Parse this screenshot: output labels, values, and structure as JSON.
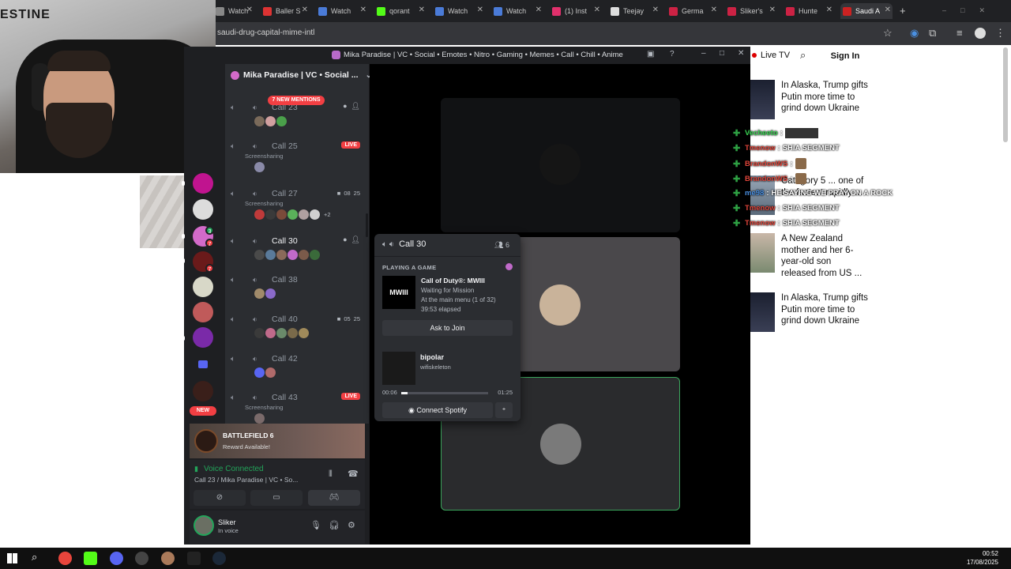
{
  "browser": {
    "tabs": [
      {
        "label": "Watch",
        "color": "#888888"
      },
      {
        "label": "Baller S",
        "color": "#dd3333"
      },
      {
        "label": "Watch",
        "color": "#4a7bd8"
      },
      {
        "label": "qorant",
        "color": "#53fc18"
      },
      {
        "label": "Watch",
        "color": "#4a7bd8"
      },
      {
        "label": "Watch",
        "color": "#4a7bd8"
      },
      {
        "label": "(1) Inst",
        "color": "#e1306c"
      },
      {
        "label": "Teejay",
        "color": "#dddddd"
      },
      {
        "label": "Germa",
        "color": "#cc2244"
      },
      {
        "label": "Sliker's",
        "color": "#cc2244"
      },
      {
        "label": "Hunte",
        "color": "#cc2244"
      },
      {
        "label": "Saudi A",
        "color": "#cc2222"
      }
    ],
    "url": "saudi-drug-capital-mime-intl"
  },
  "webcam": {
    "wall_text": "ESTINE"
  },
  "website": {
    "live_tv": "Live TV",
    "sign_in": "Sign In",
    "articles": [
      "In Alaska, Trump gifts Putin more time to grind down Ukraine",
      "Category 5 ... one of the fastest rapidly ...",
      "A New Zealand mother and her 6-year-old son released from US ...",
      "In Alaska, Trump gifts Putin more time to grind down Ukraine"
    ]
  },
  "chat": [
    {
      "user": "Vecheeto",
      "user_color": "#39d353",
      "message": "",
      "kind": "image"
    },
    {
      "user": "Tmenow",
      "user_color": "#e0453a",
      "message": "SHIA SEGMENT",
      "kind": "text"
    },
    {
      "user": "BrandonWS",
      "user_color": "#e0453a",
      "message": "",
      "kind": "emote"
    },
    {
      "user": "BrandonWS",
      "user_color": "#e0453a",
      "message": "",
      "kind": "emote"
    },
    {
      "user": "me98",
      "user_color": "#4a90e2",
      "message": "HE SAYING WE PRAY ON A ROCK",
      "kind": "text"
    },
    {
      "user": "Tmenow",
      "user_color": "#e0453a",
      "message": "SHIA SEGMENT",
      "kind": "text"
    },
    {
      "user": "Tmenow",
      "user_color": "#e0453a",
      "message": "SHIA SEGMENT",
      "kind": "text"
    }
  ],
  "discord": {
    "window_title": "Mika Paradise | VC • Social • Emotes • Nitro • Gaming • Memes • Call • Chill • Anime",
    "server_name": "Mika Paradise | VC • Social ...",
    "new_mentions": "7 NEW MENTIONS",
    "new_tag": "NEW",
    "server_badges": [
      "3",
      "7",
      "7"
    ],
    "channels": [
      {
        "name": "Call 23",
        "sub": "",
        "live": false,
        "meta": []
      },
      {
        "name": "Call 25",
        "sub": "Screensharing",
        "live": true,
        "live_label": "LIVE",
        "meta": []
      },
      {
        "name": "Call 27",
        "sub": "Screensharing",
        "live": false,
        "meta": [
          "08",
          "25"
        ],
        "more": "+2"
      },
      {
        "name": "Call 30",
        "sub": "",
        "live": false,
        "meta": []
      },
      {
        "name": "Call 38",
        "sub": "",
        "live": false,
        "meta": []
      },
      {
        "name": "Call 40",
        "sub": "",
        "live": false,
        "meta": [
          "05",
          "25"
        ]
      },
      {
        "name": "Call 42",
        "sub": "",
        "live": false,
        "meta": []
      },
      {
        "name": "Call 43",
        "sub": "Screensharing",
        "live": true,
        "live_label": "LIVE",
        "meta": []
      }
    ],
    "promo": {
      "title": "BATTLEFIELD 6",
      "subtitle": "Reward Available!"
    },
    "voice": {
      "status": "Voice Connected",
      "location": "Call 23 / Mika Paradise | VC • So..."
    },
    "user": {
      "name": "Sliker",
      "status": "In voice"
    },
    "popout": {
      "channel": "Call 30",
      "count": "6",
      "section": "PLAYING A GAME",
      "game_logo": "MWIII",
      "game_title": "Call of Duty®: MWIII",
      "game_state": "Waiting for Mission",
      "game_detail": "At the main menu (1 of 32)",
      "game_elapsed": "39:53 elapsed",
      "join_label": "Ask to Join",
      "song": "bipolar",
      "artist": "wifiskeleton",
      "time_current": "00:06",
      "time_total": "01:25",
      "progress": 0.07,
      "spotify_label": "Connect Spotify"
    }
  },
  "taskbar": {
    "time": "00:52",
    "date": "17/08/2025"
  },
  "colors": {
    "discord_green": "#23a55a",
    "discord_red": "#f23f43",
    "tile_border": "#3ba55c"
  }
}
